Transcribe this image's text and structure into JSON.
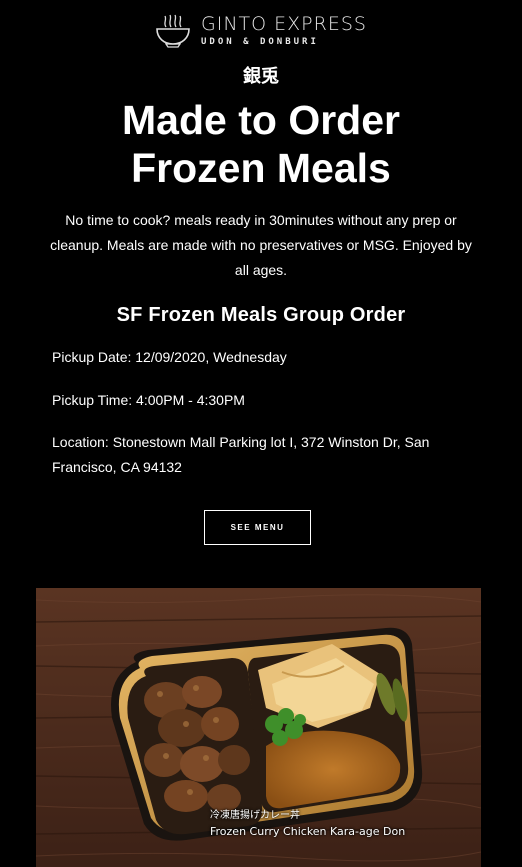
{
  "brand": {
    "name": "GINTO EXPRESS",
    "tagline": "UDON & DONBURI",
    "cjk": "銀兎"
  },
  "hero": {
    "line1": "Made to Order",
    "line2": "Frozen Meals"
  },
  "intro": "No time to cook? meals ready in 30minutes without any prep or cleanup. Meals are made with no preservatives or MSG. Enjoyed by all ages.",
  "group_order": {
    "title": "SF Frozen Meals Group Order",
    "pickup_date": "Pickup Date: 12/09/2020, Wednesday",
    "pickup_time": "Pickup Time: 4:00PM - 4:30PM",
    "location": "Location: Stonestown Mall Parking lot I, 372 Winston Dr, San Francisco, CA 94132"
  },
  "cta": {
    "label": "SEE MENU"
  },
  "photo": {
    "caption_jp": "冷凍唐揚げカレー丼",
    "caption_en": "Frozen Curry Chicken Kara-age Don"
  },
  "colors": {
    "background": "#000000",
    "text": "#ffffff"
  }
}
